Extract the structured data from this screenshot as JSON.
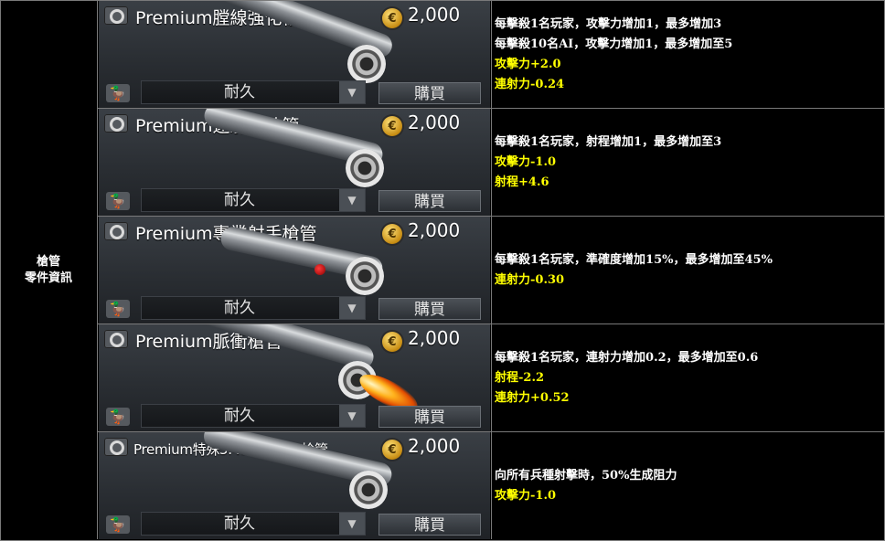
{
  "category": {
    "line1": "槍管",
    "line2": "零件資訊"
  },
  "shop": {
    "durability_label": "耐久",
    "buy_label": "購買",
    "coin_symbol": "€"
  },
  "items": [
    {
      "name": "Premium膛線強化槍管",
      "price": "2,000",
      "desc": [
        {
          "text": "每擊殺1名玩家，攻擊力增加1，最多增加3",
          "color": "white"
        },
        {
          "text": "每擊殺10名AI，攻擊力增加1，最多增加至5",
          "color": "white"
        },
        {
          "text": "攻擊力+2.0",
          "color": "yellow"
        },
        {
          "text": "連射力-0.24",
          "color": "yellow"
        }
      ]
    },
    {
      "name": "Premium遠射程槍管",
      "price": "2,000",
      "desc": [
        {
          "text": "每擊殺1名玩家，射程增加1，最多增加至3",
          "color": "white"
        },
        {
          "text": "攻擊力-1.0",
          "color": "yellow"
        },
        {
          "text": "射程+4.6",
          "color": "yellow"
        }
      ]
    },
    {
      "name": "Premium專業射手槍管",
      "price": "2,000",
      "desc": [
        {
          "text": "每擊殺1名玩家，準確度增加15%，最多增加至45%",
          "color": "white"
        },
        {
          "text": "連射力-0.30",
          "color": "yellow"
        }
      ]
    },
    {
      "name": "Premium脈衝槍管",
      "price": "2,000",
      "desc": [
        {
          "text": "每擊殺1名玩家，連射力增加0.2，最多增加至0.6",
          "color": "white"
        },
        {
          "text": "射程-2.2",
          "color": "yellow"
        },
        {
          "text": "連射力+0.52",
          "color": "yellow"
        }
      ]
    },
    {
      "name": "Premium特殊5.45X39mm槍管",
      "price": "2,000",
      "desc": [
        {
          "text": "向所有兵種射擊時，50%生成阻力",
          "color": "white"
        },
        {
          "text": "攻擊力-1.0",
          "color": "yellow"
        }
      ]
    }
  ],
  "colors": {
    "highlight": "#ffff00",
    "text": "#ffffff",
    "background": "#000000",
    "card": "#2f3338"
  }
}
